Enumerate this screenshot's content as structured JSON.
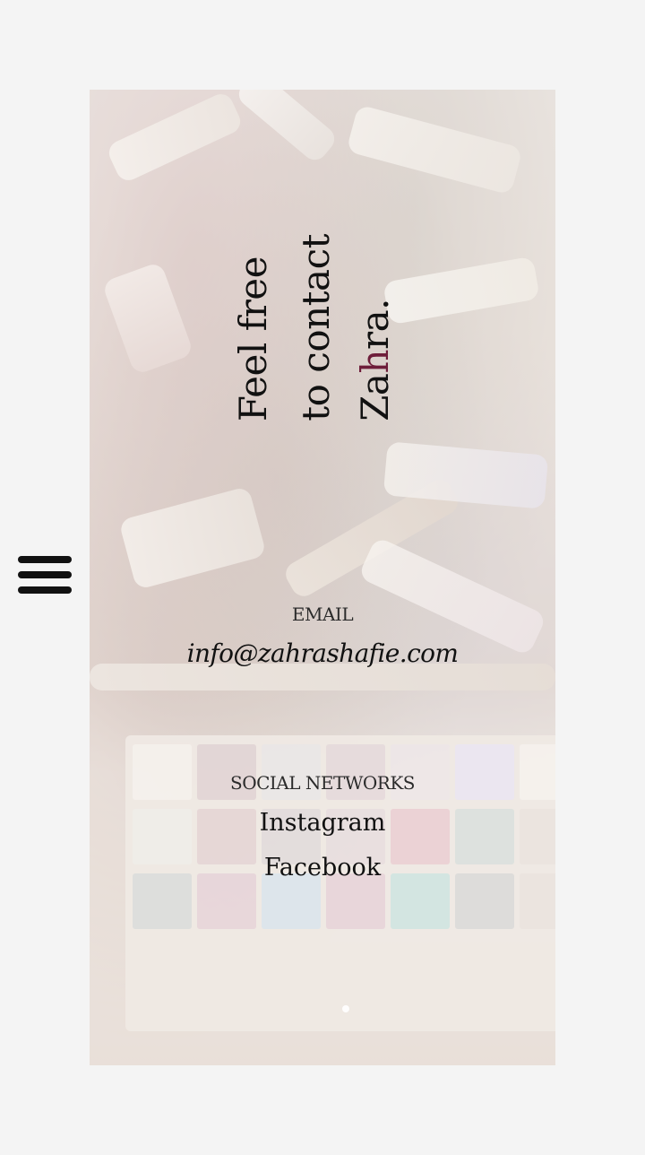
{
  "menu": {
    "icon": "hamburger-menu-icon"
  },
  "hero": {
    "line1": "Feel free",
    "line2": "to contact",
    "line3_pre": "Za",
    "line3_accent": "h",
    "line3_post": "ra.",
    "accent_color": "#6e1d3a"
  },
  "email": {
    "label": "EMAIL",
    "address": "info@zahrashafie.com"
  },
  "social": {
    "label": "SOCIAL NETWORKS",
    "links": [
      {
        "label": "Instagram"
      },
      {
        "label": "Facebook"
      }
    ]
  }
}
